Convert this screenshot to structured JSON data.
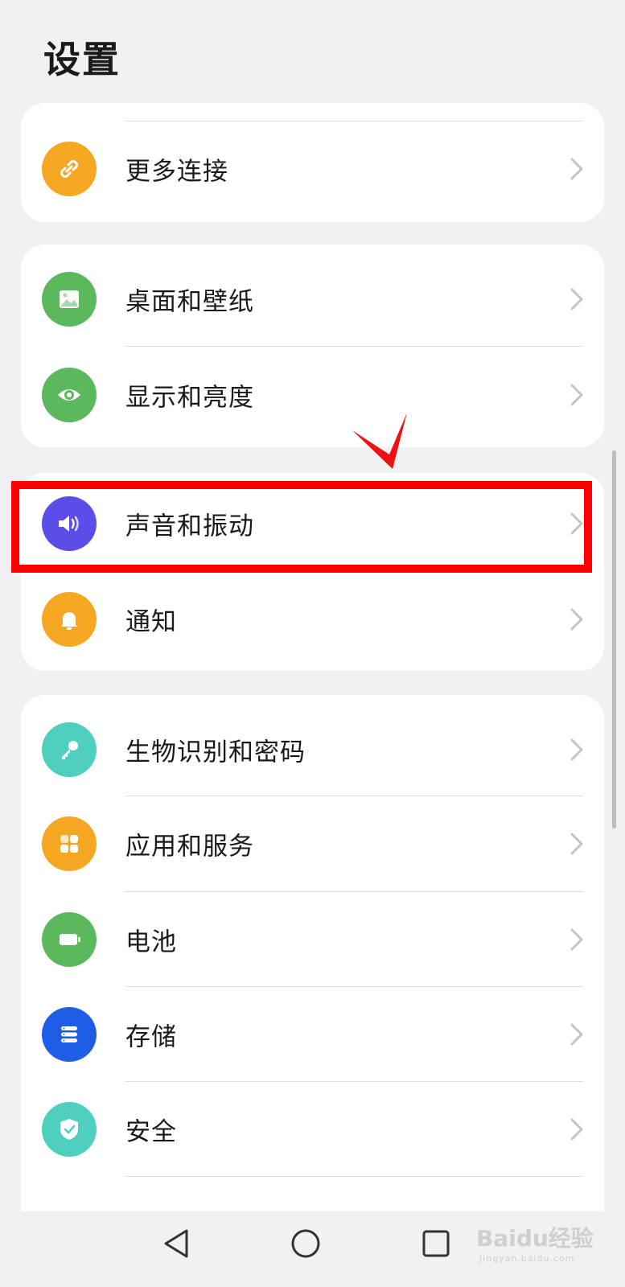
{
  "page": {
    "title": "设置"
  },
  "groups": [
    {
      "items": [
        {
          "label": "更多连接",
          "icon": "link-icon",
          "color": "#f5a623"
        }
      ]
    },
    {
      "items": [
        {
          "label": "桌面和壁纸",
          "icon": "wallpaper-icon",
          "color": "#5cb85c"
        },
        {
          "label": "显示和亮度",
          "icon": "eye-icon",
          "color": "#5cb85c"
        }
      ]
    },
    {
      "items": [
        {
          "label": "声音和振动",
          "icon": "speaker-icon",
          "color": "#5b4ee8"
        },
        {
          "label": "通知",
          "icon": "bell-icon",
          "color": "#f5a623"
        }
      ]
    },
    {
      "items": [
        {
          "label": "生物识别和密码",
          "icon": "key-icon",
          "color": "#4fcfbf"
        },
        {
          "label": "应用和服务",
          "icon": "apps-icon",
          "color": "#f5a623"
        },
        {
          "label": "电池",
          "icon": "battery-icon",
          "color": "#5cb85c"
        },
        {
          "label": "存储",
          "icon": "storage-icon",
          "color": "#1e5ee6"
        },
        {
          "label": "安全",
          "icon": "shield-icon",
          "color": "#4fcfbf"
        }
      ]
    }
  ],
  "watermark": {
    "brand": "Baidu经验",
    "url": "jingyan.baidu.com"
  },
  "colors": {
    "highlight": "#ff0000",
    "chevron": "#c4c4c4"
  }
}
